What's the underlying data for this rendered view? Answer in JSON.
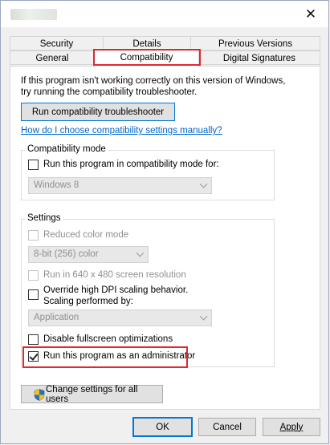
{
  "window": {
    "close_glyph": "✕"
  },
  "tabs": {
    "row_back": [
      "Security",
      "Details",
      "Previous Versions"
    ],
    "row_front": [
      "General",
      "Compatibility",
      "Digital Signatures"
    ],
    "active": "Compatibility"
  },
  "intro": {
    "line1": "If this program isn't working correctly on this version of Windows,",
    "line2": "try running the compatibility troubleshooter.",
    "troubleshooter_button": "Run compatibility troubleshooter",
    "manual_link": "How do I choose compatibility settings manually?"
  },
  "compat_mode": {
    "group_label": "Compatibility mode",
    "checkbox_label": "Run this program in compatibility mode for:",
    "checked": false,
    "os_select_value": "Windows 8"
  },
  "settings": {
    "group_label": "Settings",
    "reduced_color": {
      "label": "Reduced color mode",
      "checked": false,
      "enabled": false
    },
    "color_select_value": "8-bit (256) color",
    "res_640": {
      "label": "Run in 640 x 480 screen resolution",
      "checked": false,
      "enabled": false
    },
    "dpi": {
      "line1": "Override high DPI scaling behavior.",
      "line2": "Scaling performed by:",
      "checked": false
    },
    "dpi_select_value": "Application",
    "fullscreen": {
      "label": "Disable fullscreen optimizations",
      "checked": false
    },
    "admin": {
      "label": "Run this program as an administrator",
      "checked": true
    }
  },
  "change_all_users": "Change settings for all users",
  "footer": {
    "ok": "OK",
    "cancel": "Cancel",
    "apply": "Apply"
  },
  "highlight_color": "#e3262f",
  "icons": {
    "close": "close-icon",
    "shield": "uac-shield-icon",
    "checkmark": "checkmark-icon",
    "chevron": "chevron-down-icon"
  }
}
